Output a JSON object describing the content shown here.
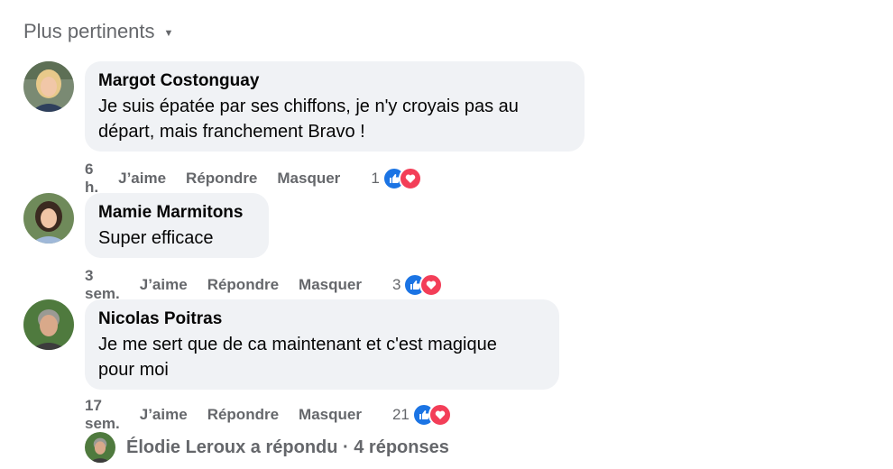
{
  "sort": {
    "label": "Plus pertinents"
  },
  "actions_labels": {
    "like": "J’aime",
    "reply": "Répondre",
    "hide": "Masquer"
  },
  "comments": [
    {
      "author": "Margot Costonguay",
      "text": "Je suis épatée par ses chiffons, je n'y croyais pas au\ndépart, mais franchement Bravo !",
      "time": "6 h.",
      "reactions_count": "1"
    },
    {
      "author": "Mamie Marmitons",
      "text": "Super efficace",
      "time": "3 sem.",
      "reactions_count": "3"
    },
    {
      "author": "Nicolas Poitras",
      "text": "Je me sert que de ca maintenant et c'est magique\npour moi",
      "time": "17 sem.",
      "reactions_count": "21"
    }
  ],
  "replies": {
    "label": "Élodie Leroux a répondu · 4 réponses"
  },
  "colors": {
    "like": "#1b74e4",
    "love": "#f33e58",
    "bubble": "#f0f2f5",
    "muted": "#65676b"
  },
  "icons": [
    "chevron-down-icon",
    "like-reaction-icon",
    "love-reaction-icon"
  ]
}
